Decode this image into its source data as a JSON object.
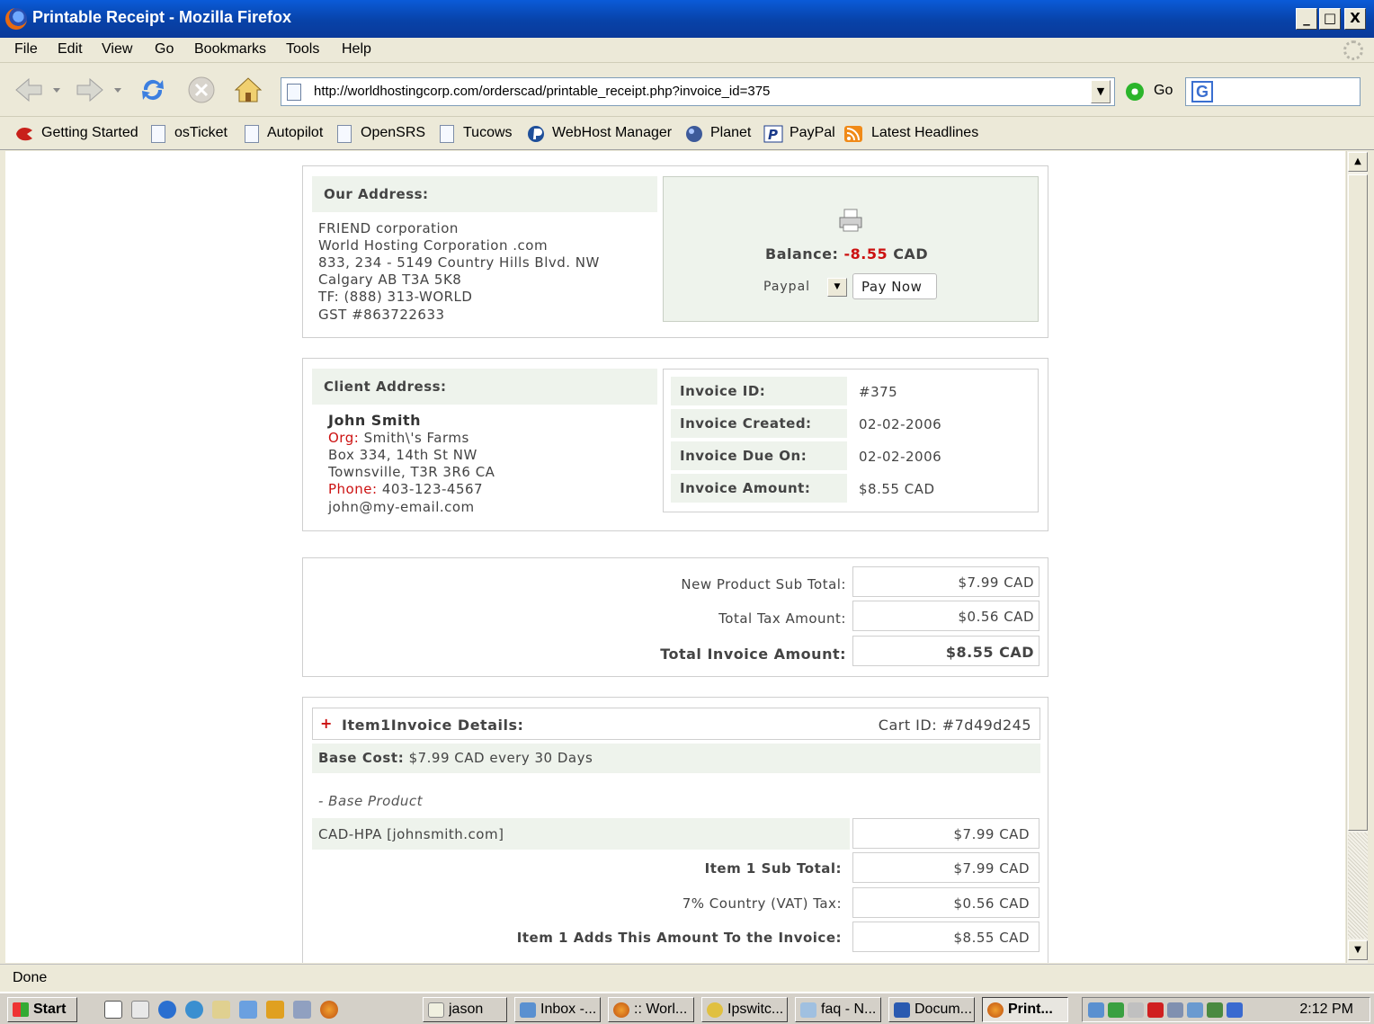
{
  "window": {
    "title": "Printable Receipt - Mozilla Firefox",
    "min": "_",
    "max": "□",
    "close": "X"
  },
  "menu": [
    "File",
    "Edit",
    "View",
    "Go",
    "Bookmarks",
    "Tools",
    "Help"
  ],
  "nav": {
    "url": "http://worldhostingcorp.com/orderscad/printable_receipt.php?invoice_id=375",
    "go_label": "Go"
  },
  "bookmarks": [
    "Getting Started",
    "osTicket",
    "Autopilot",
    "OpenSRS",
    "Tucows",
    "WebHost Manager",
    "Planet",
    "PayPal",
    "Latest Headlines"
  ],
  "our_address": {
    "heading": "Our Address:",
    "lines": [
      "FRIEND corporation",
      "World Hosting Corporation .com",
      "833, 234 - 5149 Country Hills Blvd. NW",
      "Calgary AB T3A 5K8",
      "TF: (888) 313-WORLD",
      "GST #863722633"
    ]
  },
  "balance": {
    "label": "Balance:",
    "amount": "-8.55",
    "currency": "CAD",
    "method": "Paypal",
    "pay_button": "Pay Now"
  },
  "client": {
    "heading": "Client Address:",
    "name": "John Smith",
    "org_label": "Org:",
    "org": "Smith\\'s Farms",
    "line1": "Box 334, 14th St NW",
    "line2": "Townsville, T3R 3R6 CA",
    "phone_label": "Phone:",
    "phone": "403-123-4567",
    "email": "john@my-email.com"
  },
  "invoice": [
    {
      "label": "Invoice ID:",
      "value": "#375"
    },
    {
      "label": "Invoice Created:",
      "value": "02-02-2006"
    },
    {
      "label": "Invoice Due On:",
      "value": "02-02-2006"
    },
    {
      "label": "Invoice Amount:",
      "value": "$8.55 CAD"
    }
  ],
  "totals": [
    {
      "label": "New Product Sub Total:",
      "value": "$7.99 CAD"
    },
    {
      "label": "Total Tax Amount:",
      "value": "$0.56 CAD"
    },
    {
      "label": "Total Invoice Amount:",
      "value": "$8.55 CAD"
    }
  ],
  "item": {
    "heading": "Item1Invoice Details:",
    "cart": "Cart ID: #7d49d245",
    "base_cost_label": "Base Cost:",
    "base_cost": "$7.99 CAD every 30 Days",
    "base_product": "- Base Product",
    "product": "CAD-HPA [johnsmith.com]",
    "product_price": "$7.99 CAD",
    "rows": [
      {
        "label": "Item 1 Sub Total:",
        "value": "$7.99 CAD"
      },
      {
        "label": "7% Country (VAT) Tax:",
        "value": "$0.56 CAD"
      },
      {
        "label": "Item 1 Adds This Amount To the Invoice:",
        "value": "$8.55 CAD"
      }
    ]
  },
  "status": "Done",
  "taskbar": {
    "start": "Start",
    "tasks": [
      "jason",
      "Inbox -...",
      ":: Worl...",
      "Ipswitc...",
      "faq - N...",
      "Docum...",
      "Print..."
    ],
    "clock": "2:12 PM"
  },
  "colors": {
    "titlebar": "#0a5bd8",
    "panel_tint": "#eef3ec",
    "accent_red": "#cc1111",
    "text": "#444444"
  }
}
